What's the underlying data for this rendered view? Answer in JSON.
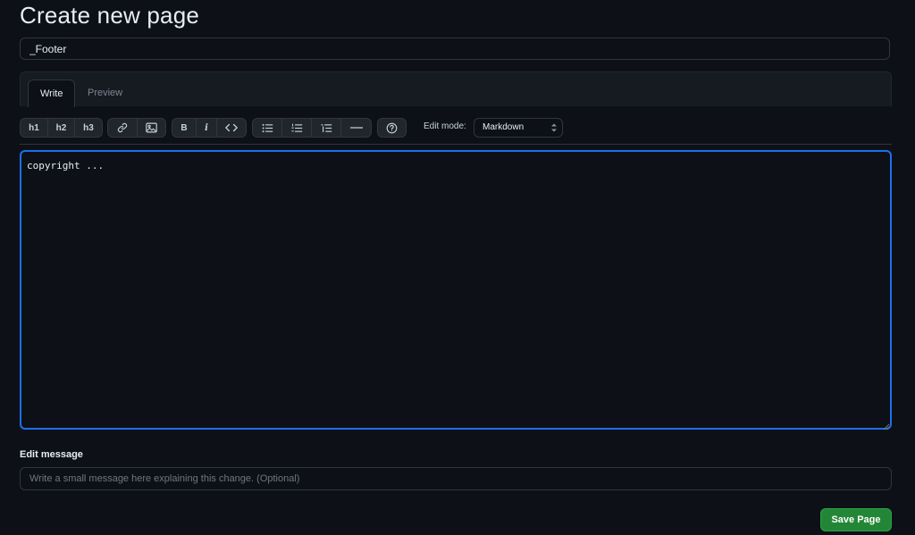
{
  "page": {
    "title": "Create new page"
  },
  "page_name_value": "_Footer",
  "tabs": [
    {
      "label": "Write",
      "active": true
    },
    {
      "label": "Preview",
      "active": false
    }
  ],
  "toolbar": {
    "h1": "h1",
    "h2": "h2",
    "h3": "h3",
    "bold": "B",
    "italic": "i",
    "icons": [
      "link-icon",
      "image-icon",
      "code-icon",
      "unordered-list-icon",
      "ordered-list-icon",
      "task-list-icon",
      "horizontal-rule-icon",
      "help-icon"
    ],
    "edit_mode_label": "Edit mode:",
    "edit_mode_value": "Markdown"
  },
  "editor": {
    "content": "copyright ..."
  },
  "edit_message": {
    "label": "Edit message",
    "placeholder": "Write a small message here explaining this change. (Optional)"
  },
  "save_button": {
    "label": "Save Page"
  },
  "colors": {
    "background": "#0d1117",
    "border": "#30363d",
    "focus_border": "#1f6feb",
    "save_button": "#238636"
  }
}
